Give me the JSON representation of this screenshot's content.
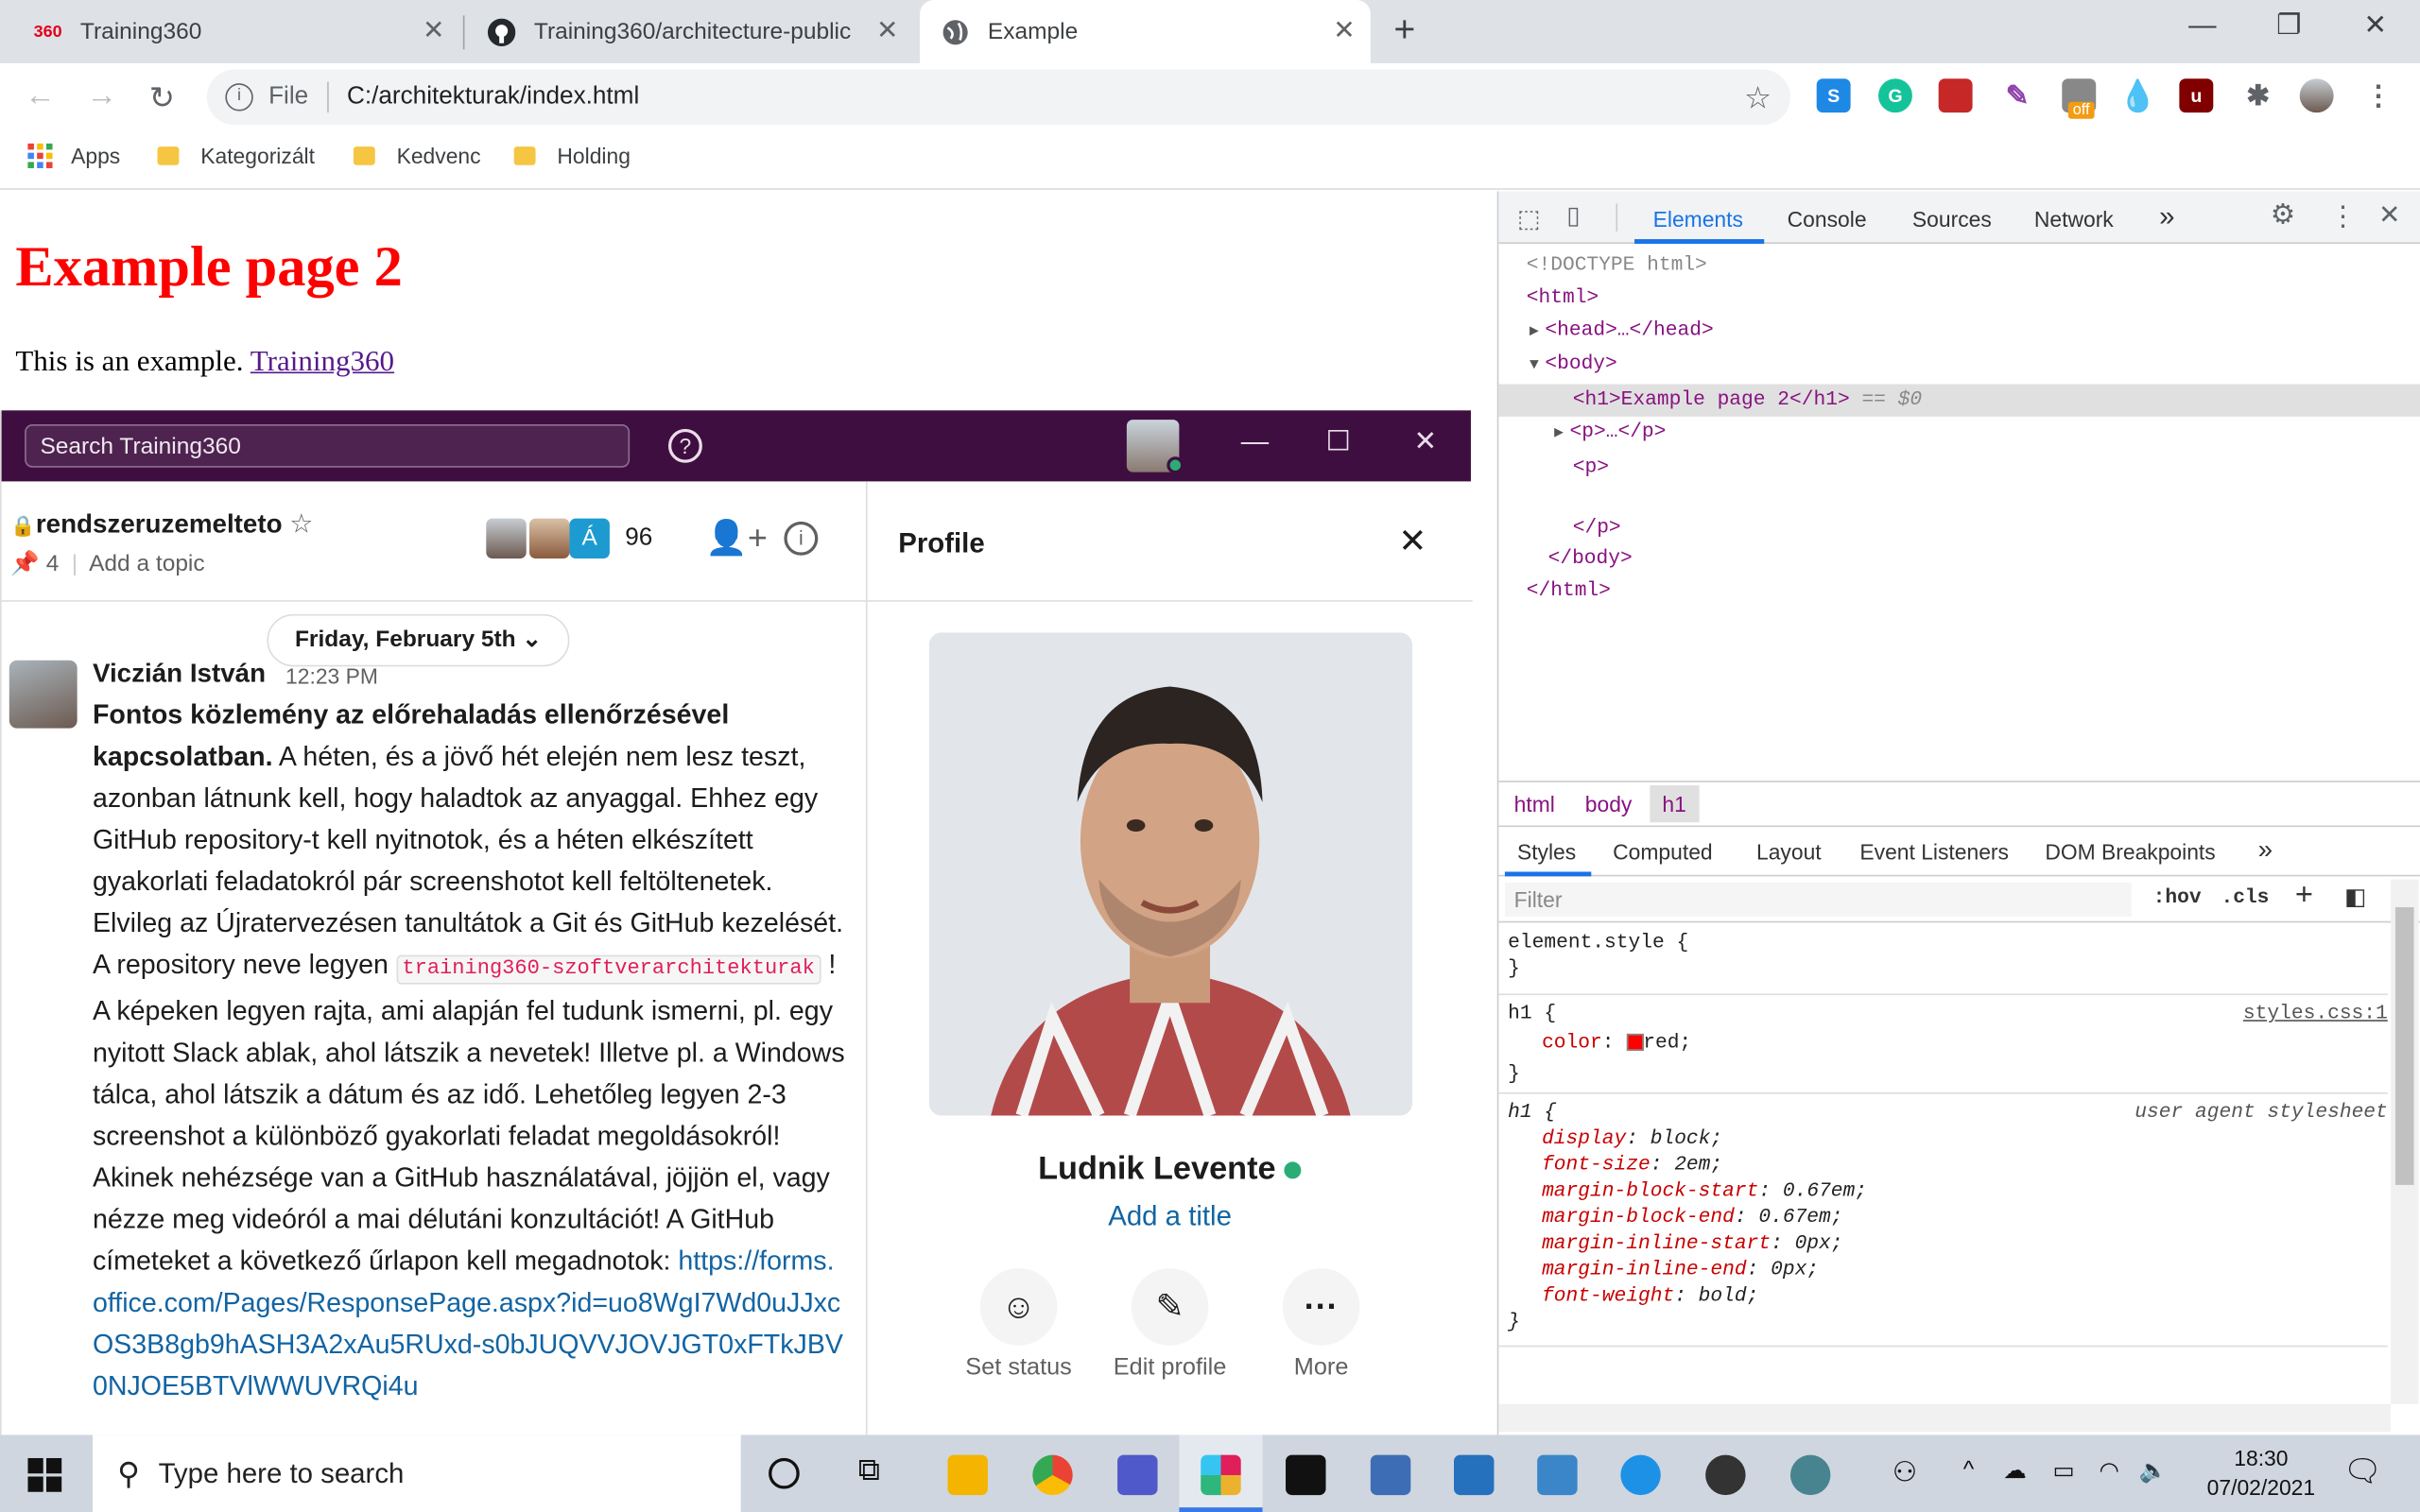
{
  "browser": {
    "tabs": [
      {
        "label": "Training360",
        "favicon": "360"
      },
      {
        "label": "Training360/architecture-public",
        "favicon": "github-icon"
      },
      {
        "label": "Example",
        "favicon": "globe-icon"
      }
    ],
    "new_tab": "+",
    "address": {
      "scheme_label": "File",
      "url": "C:/architekturak/index.html"
    },
    "bookmarks": [
      "Apps",
      "Kategorizált",
      "Kedvenc",
      "Holding"
    ],
    "extension_badge": "off"
  },
  "page": {
    "heading": "Example page 2",
    "text": "This is an example.",
    "link": "Training360"
  },
  "slack": {
    "search_placeholder": "Search Training360",
    "channel": {
      "name": "rendszeruzemelteto",
      "pins": "4",
      "topic": "Add a topic",
      "member_count": "96",
      "member_initial": "Á"
    },
    "date_divider": "Friday, February 5th",
    "message": {
      "author": "Viczián István",
      "time": "12:23 PM",
      "bold": "Fontos közlemény az előrehaladás ellenőrzésével kapcsolatban.",
      "text1": "A héten, és a jövő hét elején nem lesz teszt, azonban látnunk kell, hogy haladtok az anyaggal. Ehhez egy GitHub repository-t kell nyitnotok, és a héten elkészített gyakorlati feladatokról pár screenshotot kell feltöltenetek. Elvileg az Újratervezésen tanultátok a Git és GitHub kezelését. A repository neve legyen",
      "code": "training360-szoftverarchitekturak",
      "text2": "! A képeken legyen rajta, ami alapján fel tudunk ismerni, pl. egy nyitott Slack ablak, ahol látszik a nevetek! Illetve pl. a Windows tálca, ahol látszik a dátum és az idő. Lehetőleg legyen 2-3 screenshot a különböző gyakorlati feladat megoldásokról! Akinek nehézsége van a GitHub használatával, jöjjön el, vagy nézze meg videóról a mai délutáni konzultációt! A GitHub címeteket a következő űrlapon kell megadnotok:",
      "link": "https://forms.office.com/Pages/ResponsePage.aspx?id=uo8WgI7Wd0uJJxcOS3B8gb9hASH3A2xAu5RUxd-s0bJUQVVJOVJGT0xFTkJBV0NJOE5BTVlWWUVRQi4u"
    },
    "profile": {
      "title": "Profile",
      "name": "Ludnik Levente",
      "add_title": "Add a title",
      "actions": [
        "Set status",
        "Edit profile",
        "More"
      ]
    }
  },
  "devtools": {
    "tabs": [
      "Elements",
      "Console",
      "Sources",
      "Network"
    ],
    "dom": {
      "doctype": "<!DOCTYPE html>",
      "html_open": "<html>",
      "head": "<head>…</head>",
      "body_open": "<body>",
      "h1": "<h1>Example page 2</h1>",
      "h1_suffix": "== $0",
      "p_collapsed": "<p>…</p>",
      "p_open": "<p>",
      "p_close": "</p>",
      "body_close": "</body>",
      "html_close": "</html>"
    },
    "breadcrumbs": [
      "html",
      "body",
      "h1"
    ],
    "style_tabs": [
      "Styles",
      "Computed",
      "Layout",
      "Event Listeners",
      "DOM Breakpoints"
    ],
    "filter_placeholder": "Filter",
    "hov": ":hov",
    "cls": ".cls",
    "rules": {
      "element_style": "element.style {",
      "close": "}",
      "h1_selector": "h1 {",
      "h1_source": "styles.css:1",
      "color_prop": "color",
      "color_value": "red;",
      "ua_source": "user agent stylesheet",
      "ua_props": [
        {
          "p": "display",
          "v": "block;"
        },
        {
          "p": "font-size",
          "v": "2em;"
        },
        {
          "p": "margin-block-start",
          "v": "0.67em;"
        },
        {
          "p": "margin-block-end",
          "v": "0.67em;"
        },
        {
          "p": "margin-inline-start",
          "v": "0px;"
        },
        {
          "p": "margin-inline-end",
          "v": "0px;"
        },
        {
          "p": "font-weight",
          "v": "bold;"
        }
      ]
    }
  },
  "taskbar": {
    "search_placeholder": "Type here to search",
    "time": "18:30",
    "date": "07/02/2021"
  },
  "colors": {
    "slack_aubergine": "#3f0e40",
    "heading_red": "#ff0000",
    "link_blue": "#1264a3",
    "online_green": "#2bac76"
  }
}
